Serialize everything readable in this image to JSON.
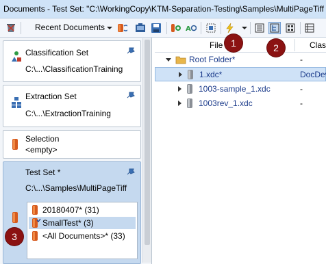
{
  "window": {
    "title": "Documents - Test Set: \"C:\\WorkingCopy\\KTM-Separation-Testing\\Samples\\MultiPageTiff"
  },
  "toolbar": {
    "recent_documents_label": "Recent Documents",
    "icons": [
      "delete-icon",
      "recent-documents-icon",
      "open-folder-icon",
      "save-icon",
      "sets-icon",
      "ao-icon",
      "select-icon",
      "lightning-icon",
      "list-view-icon",
      "tree-view-icon",
      "thumbnail-view-icon",
      "details-view-icon"
    ]
  },
  "left_pane": {
    "cards": [
      {
        "title": "Classification Set",
        "path": "C:\\...\\ClassificationTraining"
      },
      {
        "title": "Extraction Set",
        "path": "C:\\...\\ExtractionTraining"
      },
      {
        "title": "Selection",
        "path": "<empty>"
      },
      {
        "title": "Test Set *",
        "path": "C:\\...\\Samples\\MultiPageTiff"
      }
    ],
    "documents": [
      {
        "label": "20180407*",
        "count": "(31)"
      },
      {
        "label": "SmallTest*",
        "count": "(3)"
      },
      {
        "label": "<All Documents>*",
        "count": "(33)"
      }
    ]
  },
  "right_pane": {
    "columns": [
      "File",
      "Class"
    ],
    "root_folder": "Root Folder*",
    "files": [
      {
        "name": "1.xdc*",
        "class": "DocDev"
      },
      {
        "name": "1003-sample_1.xdc",
        "class": "-"
      },
      {
        "name": "1003rev_1.xdc",
        "class": "-"
      }
    ],
    "root_class": "-"
  },
  "callouts": [
    "1",
    "2",
    "3"
  ],
  "colors": {
    "callout": "#8b1212",
    "selection": "#c5d9ef",
    "folder": "#e8b64a",
    "link": "#1a3a8a"
  }
}
